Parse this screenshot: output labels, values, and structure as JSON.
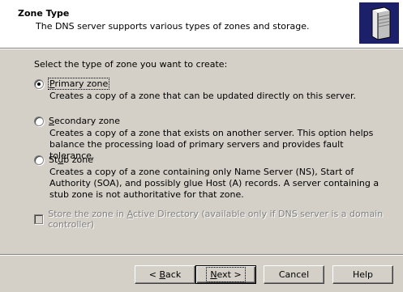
{
  "header": {
    "title": "Zone Type",
    "subtitle": "The DNS server supports various types of zones and storage.",
    "icon": "server-icon"
  },
  "prompt": "Select the type of zone you want to create:",
  "options": [
    {
      "label_pre": "",
      "label_mnemonic": "P",
      "label_post": "rimary zone",
      "checked": true,
      "description": "Creates a copy of a zone that can be updated directly on this server."
    },
    {
      "label_pre": "",
      "label_mnemonic": "S",
      "label_post": "econdary zone",
      "checked": false,
      "description": "Creates a copy of a zone that exists on another server. This option helps balance the processing load of primary servers and provides fault tolerance."
    },
    {
      "label_pre": "St",
      "label_mnemonic": "u",
      "label_post": "b zone",
      "checked": false,
      "description": "Creates a copy of a zone containing only Name Server (NS), Start of Authority (SOA), and possibly glue Host (A) records. A server containing a stub zone is not authoritative for that zone."
    }
  ],
  "store_ad": {
    "label_pre": "Store the zone in ",
    "label_mnemonic": "A",
    "label_post": "ctive Directory (available only if DNS server is a domain controller)",
    "checked": false,
    "enabled": false
  },
  "buttons": {
    "back": {
      "pre": "< ",
      "mnemonic": "B",
      "post": "ack"
    },
    "next": {
      "pre": "",
      "mnemonic": "N",
      "post": "ext >"
    },
    "cancel": {
      "label": "Cancel"
    },
    "help": {
      "label": "Help"
    }
  },
  "colors": {
    "dialog_bg": "#d4d0c8",
    "header_bg": "#ffffff",
    "icon_bg": "#1c1f6a",
    "disabled_text": "#808080"
  }
}
